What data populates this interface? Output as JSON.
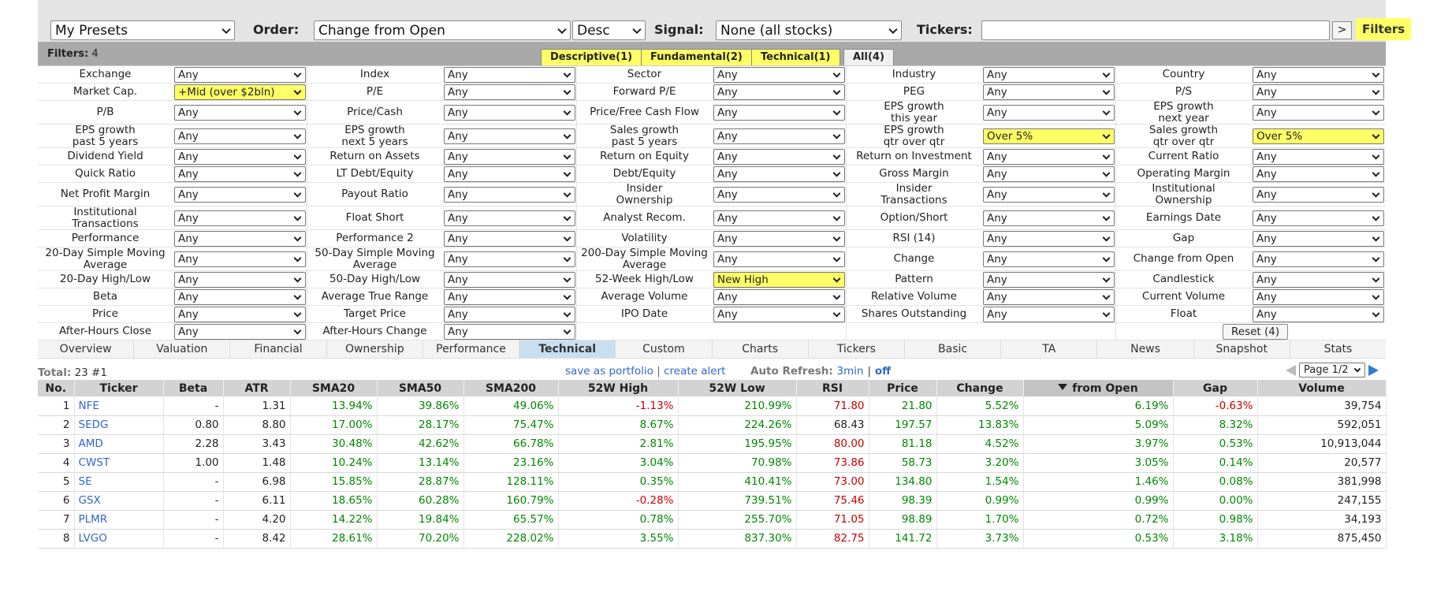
{
  "topbar": {
    "presets": "My Presets",
    "order_label": "Order:",
    "order_value": "Change from Open",
    "direction": "Desc",
    "signal_label": "Signal:",
    "signal_value": "None (all stocks)",
    "tickers_label": "Tickers:",
    "tickers_value": "",
    "go_label": ">",
    "filters_label": "Filters"
  },
  "filter_header": {
    "label": "Filters:",
    "count": "4",
    "tabs": [
      "Descriptive(1)",
      "Fundamental(2)",
      "Technical(1)",
      "All(4)"
    ]
  },
  "filters": [
    [
      [
        "Exchange",
        "Any",
        false
      ],
      [
        "Index",
        "Any",
        false
      ],
      [
        "Sector",
        "Any",
        false
      ],
      [
        "Industry",
        "Any",
        false
      ],
      [
        "Country",
        "Any",
        false
      ]
    ],
    [
      [
        "Market Cap.",
        "+Mid (over $2bln)",
        true
      ],
      [
        "P/E",
        "Any",
        false
      ],
      [
        "Forward P/E",
        "Any",
        false
      ],
      [
        "PEG",
        "Any",
        false
      ],
      [
        "P/S",
        "Any",
        false
      ]
    ],
    [
      [
        "P/B",
        "Any",
        false
      ],
      [
        "Price/Cash",
        "Any",
        false
      ],
      [
        "Price/Free Cash Flow",
        "Any",
        false
      ],
      [
        "EPS growth\nthis year",
        "Any",
        false
      ],
      [
        "EPS growth\nnext year",
        "Any",
        false
      ]
    ],
    [
      [
        "EPS growth\npast 5 years",
        "Any",
        false
      ],
      [
        "EPS growth\nnext 5 years",
        "Any",
        false
      ],
      [
        "Sales growth\npast 5 years",
        "Any",
        false
      ],
      [
        "EPS growth\nqtr over qtr",
        "Over 5%",
        true
      ],
      [
        "Sales growth\nqtr over qtr",
        "Over 5%",
        true
      ]
    ],
    [
      [
        "Dividend Yield",
        "Any",
        false
      ],
      [
        "Return on Assets",
        "Any",
        false
      ],
      [
        "Return on Equity",
        "Any",
        false
      ],
      [
        "Return on Investment",
        "Any",
        false
      ],
      [
        "Current Ratio",
        "Any",
        false
      ]
    ],
    [
      [
        "Quick Ratio",
        "Any",
        false
      ],
      [
        "LT Debt/Equity",
        "Any",
        false
      ],
      [
        "Debt/Equity",
        "Any",
        false
      ],
      [
        "Gross Margin",
        "Any",
        false
      ],
      [
        "Operating Margin",
        "Any",
        false
      ]
    ],
    [
      [
        "Net Profit Margin",
        "Any",
        false
      ],
      [
        "Payout Ratio",
        "Any",
        false
      ],
      [
        "Insider\nOwnership",
        "Any",
        false
      ],
      [
        "Insider\nTransactions",
        "Any",
        false
      ],
      [
        "Institutional\nOwnership",
        "Any",
        false
      ]
    ],
    [
      [
        "Institutional\nTransactions",
        "Any",
        false
      ],
      [
        "Float Short",
        "Any",
        false
      ],
      [
        "Analyst Recom.",
        "Any",
        false
      ],
      [
        "Option/Short",
        "Any",
        false
      ],
      [
        "Earnings Date",
        "Any",
        false
      ]
    ],
    [
      [
        "Performance",
        "Any",
        false
      ],
      [
        "Performance 2",
        "Any",
        false
      ],
      [
        "Volatility",
        "Any",
        false
      ],
      [
        "RSI (14)",
        "Any",
        false
      ],
      [
        "Gap",
        "Any",
        false
      ]
    ],
    [
      [
        "20-Day Simple Moving\nAverage",
        "Any",
        false
      ],
      [
        "50-Day Simple Moving\nAverage",
        "Any",
        false
      ],
      [
        "200-Day Simple Moving\nAverage",
        "Any",
        false
      ],
      [
        "Change",
        "Any",
        false
      ],
      [
        "Change from Open",
        "Any",
        false
      ]
    ],
    [
      [
        "20-Day High/Low",
        "Any",
        false
      ],
      [
        "50-Day High/Low",
        "Any",
        false
      ],
      [
        "52-Week High/Low",
        "New High",
        true
      ],
      [
        "Pattern",
        "Any",
        false
      ],
      [
        "Candlestick",
        "Any",
        false
      ]
    ],
    [
      [
        "Beta",
        "Any",
        false
      ],
      [
        "Average True Range",
        "Any",
        false
      ],
      [
        "Average Volume",
        "Any",
        false
      ],
      [
        "Relative Volume",
        "Any",
        false
      ],
      [
        "Current Volume",
        "Any",
        false
      ]
    ],
    [
      [
        "Price",
        "Any",
        false
      ],
      [
        "Target Price",
        "Any",
        false
      ],
      [
        "IPO Date",
        "Any",
        false
      ],
      [
        "Shares Outstanding",
        "Any",
        false
      ],
      [
        "Float",
        "Any",
        false
      ]
    ],
    [
      [
        "After-Hours Close",
        "Any",
        false
      ],
      [
        "After-Hours Change",
        "Any",
        false
      ]
    ]
  ],
  "reset_label": "Reset (4)",
  "view_tabs": [
    "Overview",
    "Valuation",
    "Financial",
    "Ownership",
    "Performance",
    "Technical",
    "Custom",
    "Charts",
    "Tickers",
    "Basic",
    "TA",
    "News",
    "Snapshot",
    "Stats"
  ],
  "active_view": "Technical",
  "info": {
    "total_label": "Total:",
    "total_value": "23 #1",
    "save_portfolio": "save as portfolio",
    "separator": "|",
    "create_alert": "create alert",
    "auto_refresh_label": "Auto Refresh:",
    "refresh_value": "3min",
    "refresh_off": "off",
    "page": "Page 1/2"
  },
  "table": {
    "headers": [
      "No.",
      "Ticker",
      "Beta",
      "ATR",
      "SMA20",
      "SMA50",
      "SMA200",
      "52W High",
      "52W Low",
      "RSI",
      "Price",
      "Change",
      "from Open",
      "Gap",
      "Volume"
    ],
    "rows": [
      [
        "1",
        "NFE",
        "-",
        "1.31",
        "13.94%",
        "39.86%",
        "49.06%",
        "-1.13%",
        "210.99%",
        "71.80",
        "21.80",
        "5.52%",
        "6.19%",
        "-0.63%",
        "39,754"
      ],
      [
        "2",
        "SEDG",
        "0.80",
        "8.80",
        "17.00%",
        "28.17%",
        "75.47%",
        "8.67%",
        "224.26%",
        "68.43",
        "197.57",
        "13.83%",
        "5.09%",
        "8.32%",
        "592,051"
      ],
      [
        "3",
        "AMD",
        "2.28",
        "3.43",
        "30.48%",
        "42.62%",
        "66.78%",
        "2.81%",
        "195.95%",
        "80.00",
        "81.18",
        "4.52%",
        "3.97%",
        "0.53%",
        "10,913,044"
      ],
      [
        "4",
        "CWST",
        "1.00",
        "1.48",
        "10.24%",
        "13.14%",
        "23.16%",
        "3.04%",
        "70.98%",
        "73.86",
        "58.73",
        "3.20%",
        "3.05%",
        "0.14%",
        "20,577"
      ],
      [
        "5",
        "SE",
        "-",
        "6.98",
        "15.85%",
        "28.87%",
        "128.11%",
        "0.35%",
        "410.41%",
        "73.00",
        "134.80",
        "1.54%",
        "1.46%",
        "0.08%",
        "381,998"
      ],
      [
        "6",
        "GSX",
        "-",
        "6.11",
        "18.65%",
        "60.28%",
        "160.79%",
        "-0.28%",
        "739.51%",
        "75.46",
        "98.39",
        "0.99%",
        "0.99%",
        "0.00%",
        "247,155"
      ],
      [
        "7",
        "PLMR",
        "-",
        "4.20",
        "14.22%",
        "19.84%",
        "65.57%",
        "0.78%",
        "255.70%",
        "71.05",
        "98.89",
        "1.70%",
        "0.72%",
        "0.98%",
        "34,193"
      ],
      [
        "8",
        "LVGO",
        "-",
        "8.42",
        "28.61%",
        "70.20%",
        "228.02%",
        "3.55%",
        "837.30%",
        "82.75",
        "141.72",
        "3.73%",
        "0.53%",
        "3.18%",
        "875,450"
      ]
    ],
    "colors": {
      "positive": "#008800",
      "negative": "#cc0000",
      "link": "#3366cc",
      "highlight": "#ffff66"
    }
  }
}
